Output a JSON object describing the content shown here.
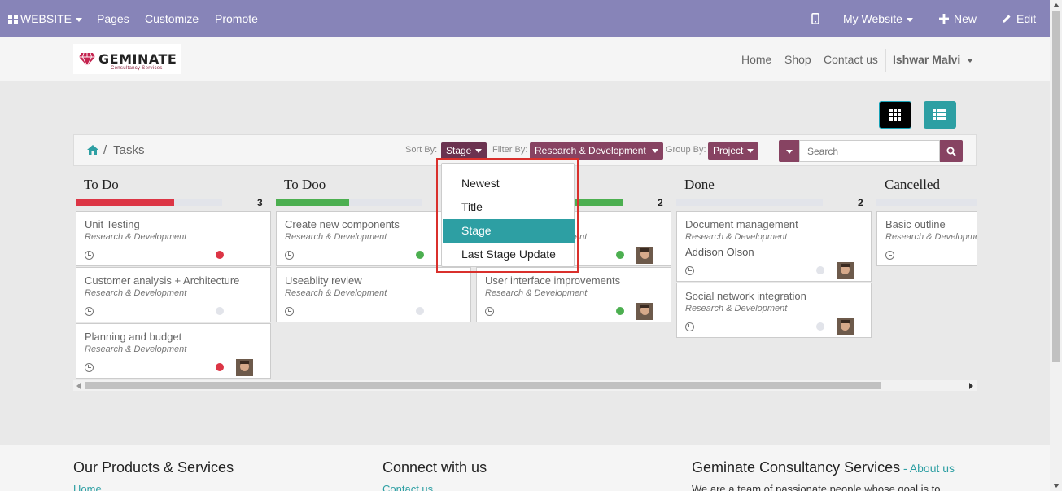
{
  "adminbar": {
    "website_menu": "WEBSITE",
    "pages": "Pages",
    "customize": "Customize",
    "promote": "Promote",
    "my_website": "My Website",
    "new": "New",
    "edit": "Edit",
    "bg_color": "#8784b8"
  },
  "header": {
    "logo_text": "GEMINATE",
    "logo_subtext": "Consultancy Services",
    "nav": [
      "Home",
      "Shop",
      "Contact us"
    ],
    "user": "Ishwar Malvi"
  },
  "breadcrumb": {
    "current": "Tasks"
  },
  "controls": {
    "sort_label": "Sort By:",
    "sort_value": "Stage",
    "filter_label": "Filter By:",
    "filter_value": "Research & Development",
    "group_label": "Group By:",
    "group_value": "Project",
    "search_placeholder": "Search",
    "accent": "#874362"
  },
  "sort_menu": {
    "options": [
      "Newest",
      "Title",
      "Stage",
      "Last Stage Update"
    ],
    "selected": "Stage",
    "highlight_color": "#2d9fa3"
  },
  "columns": [
    {
      "title": "To Do",
      "count": "3",
      "progress": 0.67,
      "bar_color": "#dc3545",
      "cards": [
        {
          "title": "Unit Testing",
          "project": "Research & Development",
          "status": "red",
          "avatar": false
        },
        {
          "title": "Customer analysis + Architecture",
          "project": "Research & Development",
          "status": "grey",
          "avatar": false
        },
        {
          "title": "Planning and budget",
          "project": "Research & Development",
          "status": "red",
          "avatar": true
        }
      ]
    },
    {
      "title": "To Doo",
      "count": "",
      "progress": 0.5,
      "bar_color": "#4caf50",
      "cards": [
        {
          "title": "Create new components",
          "project": "Research & Development",
          "status": "green",
          "avatar": false
        },
        {
          "title": "Useablity review",
          "project": "Research & Development",
          "status": "grey",
          "avatar": false
        }
      ]
    },
    {
      "title": "",
      "count": "2",
      "progress": 1.0,
      "bar_color": "#4caf50",
      "cards": [
        {
          "title": "",
          "project": "Research & Development",
          "status": "green",
          "avatar": true
        },
        {
          "title": "User interface improvements",
          "project": "Research & Development",
          "status": "green",
          "avatar": true
        }
      ]
    },
    {
      "title": "Done",
      "count": "2",
      "progress": 0,
      "bar_color": "#e2e4ea",
      "cards": [
        {
          "title": "Document management",
          "project": "Research & Development",
          "assignee": "Addison Olson",
          "status": "grey",
          "avatar": true
        },
        {
          "title": "Social network integration",
          "project": "Research & Development",
          "status": "grey",
          "avatar": true
        }
      ]
    },
    {
      "title": "Cancelled",
      "count": "",
      "progress": 0,
      "bar_color": "#e2e4ea",
      "cards": [
        {
          "title": "Basic outline",
          "project": "Research & Development",
          "status": "none",
          "avatar": false
        }
      ]
    }
  ],
  "status_colors": {
    "red": "#dc3545",
    "green": "#4caf50",
    "grey": "#e2e4ea"
  },
  "footer": {
    "col1_title": "Our Products & Services",
    "col1_link": "Home",
    "col2_title": "Connect with us",
    "col2_link": "Contact us",
    "col3_title": "Geminate Consultancy Services",
    "col3_sep": " - ",
    "col3_link": "About us",
    "col3_text": "We are a team of passionate people whose goal is to"
  }
}
